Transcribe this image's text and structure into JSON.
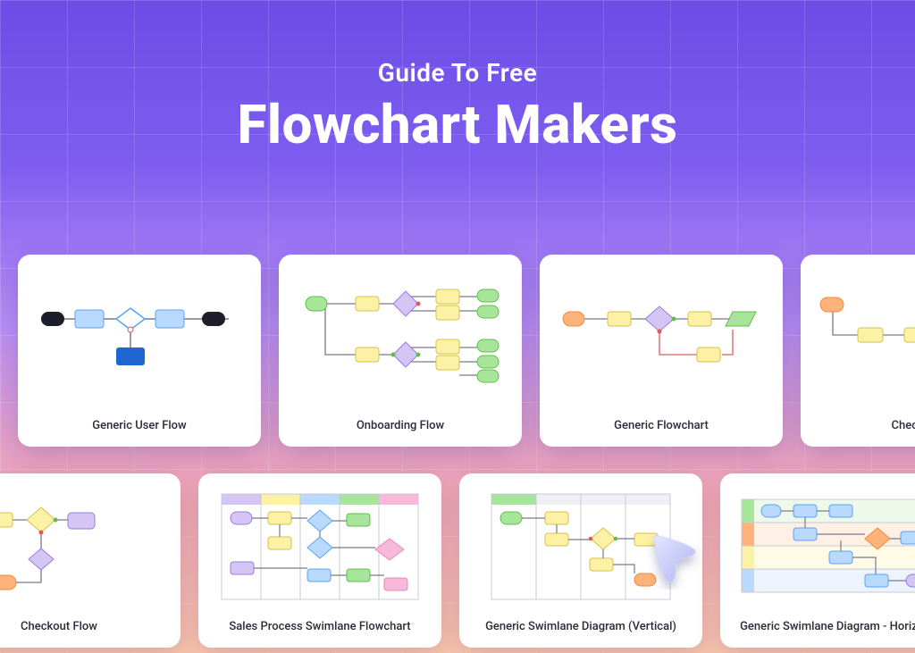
{
  "hero": {
    "subtitle": "Guide To Free",
    "title": "Flowchart Makers"
  },
  "row1": [
    {
      "id": "generic-user-flow",
      "label": "Generic User Flow",
      "thumb": "userflow"
    },
    {
      "id": "onboarding-flow",
      "label": "Onboarding Flow",
      "thumb": "onboarding"
    },
    {
      "id": "generic-flowchart",
      "label": "Generic Flowchart",
      "thumb": "genericflow"
    },
    {
      "id": "checkout-flow",
      "label": "Checkout Fl",
      "thumb": "checkout-partial"
    }
  ],
  "row2": [
    {
      "id": "checkout-flow-2",
      "label": "Checkout Flow",
      "thumb": "checkout2"
    },
    {
      "id": "sales-swimlane",
      "label": "Sales Process Swimlane Flowchart",
      "thumb": "swimlane-sales"
    },
    {
      "id": "swimlane-vertical",
      "label": "Generic Swimlane Diagram (Vertical)",
      "thumb": "swimlane-vert"
    },
    {
      "id": "swimlane-horizontal",
      "label": "Generic Swimlane Diagram - Horizontal",
      "thumb": "swimlane-horiz"
    }
  ],
  "colors": {
    "yellow": "#fdf1a5",
    "yellowStroke": "#d6c24a",
    "green": "#a7e69a",
    "greenStroke": "#5fbf4a",
    "orange": "#ffb27a",
    "orangeStroke": "#f28a3a",
    "blueLight": "#b9d9ff",
    "blueMid": "#5ba3f5",
    "blueDark": "#1f66d0",
    "purpleLight": "#d4c5f5",
    "purpleStroke": "#9b7ae0",
    "pink": "#f7b8d9",
    "dark": "#1e1e2a",
    "line": "#7a7a8c",
    "red": "#e05a5a"
  }
}
